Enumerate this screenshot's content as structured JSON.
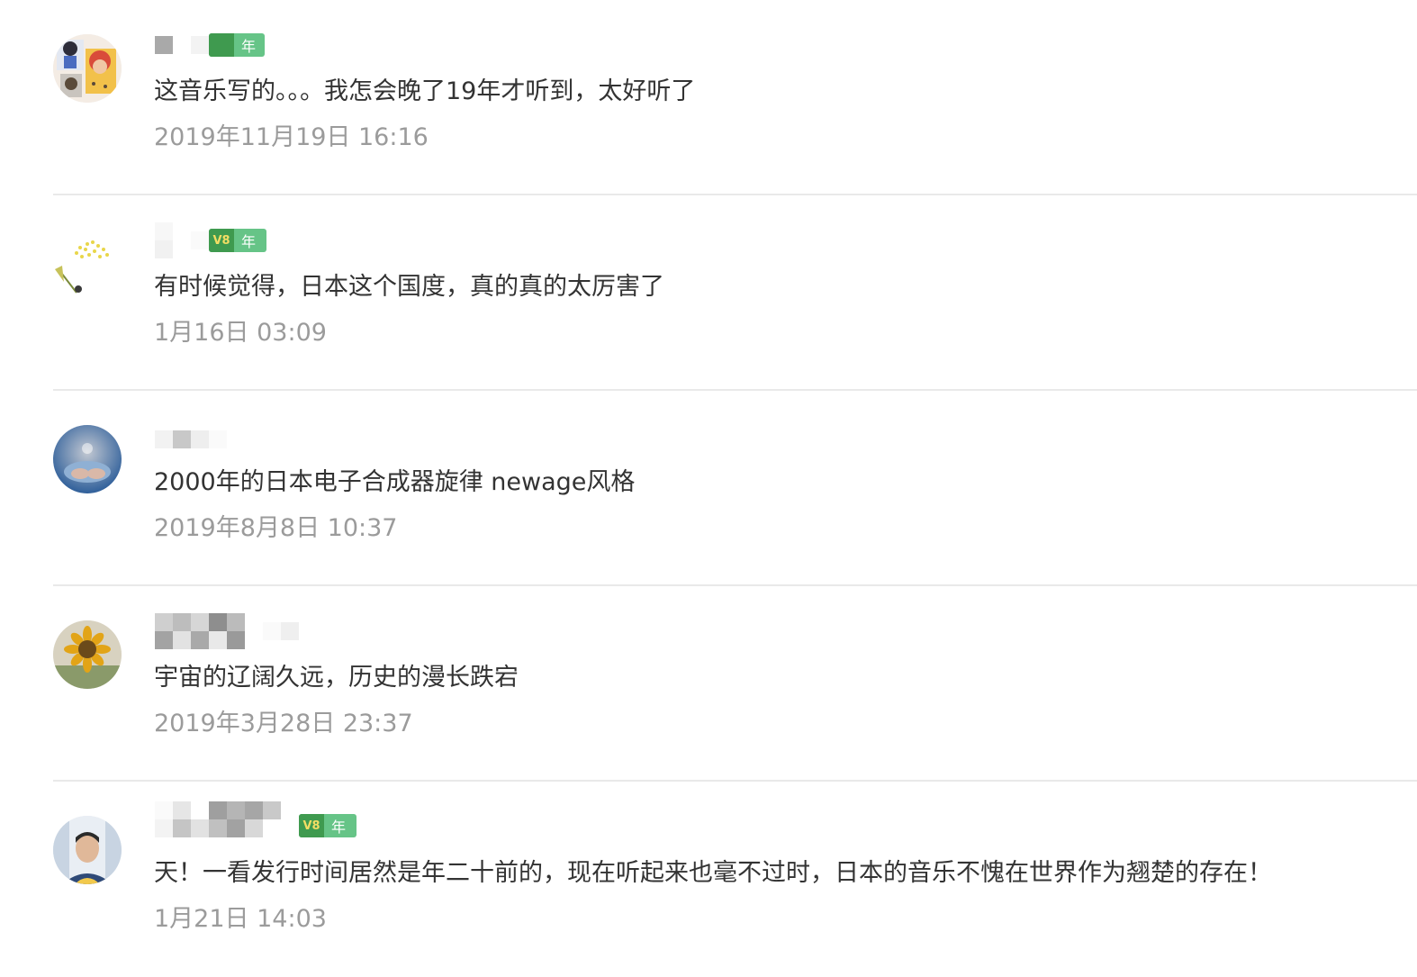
{
  "comments": [
    {
      "content": "这音乐写的。。。我怎会晚了19年才听到，太好听了",
      "time": "2019年11月19日 16:16",
      "badge_year": "年",
      "badge_mark": "",
      "avatar_icon": "collage-avatar-icon",
      "avatar_colors": [
        "#f4ece4",
        "#d94b3a",
        "#f2c14a",
        "#5a4a3a"
      ]
    },
    {
      "content": "有时候觉得，日本这个国度，真的真的太厉害了",
      "time": "1月16日 03:09",
      "badge_year": "年",
      "badge_mark": "V8",
      "avatar_icon": "dandelion-avatar-icon",
      "avatar_colors": [
        "#ffffff",
        "#e8d64a",
        "#7a8a3a",
        "#3a3a3a"
      ]
    },
    {
      "content": "2000年的日本电子合成器旋律 newage风格",
      "time": "2019年8月8日 10:37",
      "avatar_icon": "hands-avatar-icon",
      "avatar_colors": [
        "#2f5f9a",
        "#8fb0d4",
        "#d9b8a8",
        "#c2c8d2"
      ]
    },
    {
      "content": "宇宙的辽阔久远，历史的漫长跌宕",
      "time": "2019年3月28日 23:37",
      "avatar_icon": "sunflower-avatar-icon",
      "avatar_colors": [
        "#d8d2c0",
        "#e2a417",
        "#6b4a1a",
        "#8a9a6a"
      ]
    },
    {
      "content": "天！一看发行时间居然是年二十前的，现在听起来也毫不过时，日本的音乐不愧在世界作为翘楚的存在！",
      "time": "1月21日 14:03",
      "badge_year": "年",
      "badge_mark": "V8",
      "avatar_icon": "person-avatar-icon",
      "avatar_colors": [
        "#e9eef4",
        "#2f4a78",
        "#f2c94c",
        "#e0b899"
      ]
    }
  ],
  "colors": {
    "text": "#333333",
    "time": "#9b9b9b",
    "divider": "#e9e9e9",
    "badge_green": "#66c487",
    "badge_dark_green": "#3f9a4f"
  }
}
